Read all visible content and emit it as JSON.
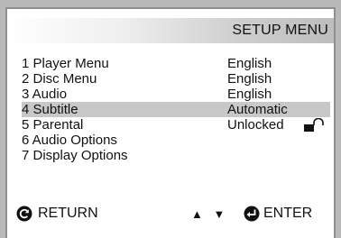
{
  "header": {
    "title": "SETUP  MENU"
  },
  "menu": {
    "items": [
      {
        "label": "1  Player Menu",
        "value": "English"
      },
      {
        "label": "2  Disc Menu",
        "value": "English"
      },
      {
        "label": "3  Audio",
        "value": "English"
      },
      {
        "label": "4  Subtitle",
        "value": "Automatic",
        "selected": true
      },
      {
        "label": "5  Parental",
        "value": "Unlocked",
        "icon": "unlocked-padlock-icon"
      },
      {
        "label": "6  Audio Options",
        "value": ""
      },
      {
        "label": "7  Display Options",
        "value": ""
      }
    ]
  },
  "footer": {
    "return_label": "RETURN",
    "return_icon": "return-icon",
    "nav_arrows": "▲ ▼",
    "enter_label": "ENTER",
    "enter_icon": "enter-icon"
  },
  "colors": {
    "highlight": "#c8c8c8",
    "background": "#b9b9b9",
    "panel": "#ffffff"
  }
}
